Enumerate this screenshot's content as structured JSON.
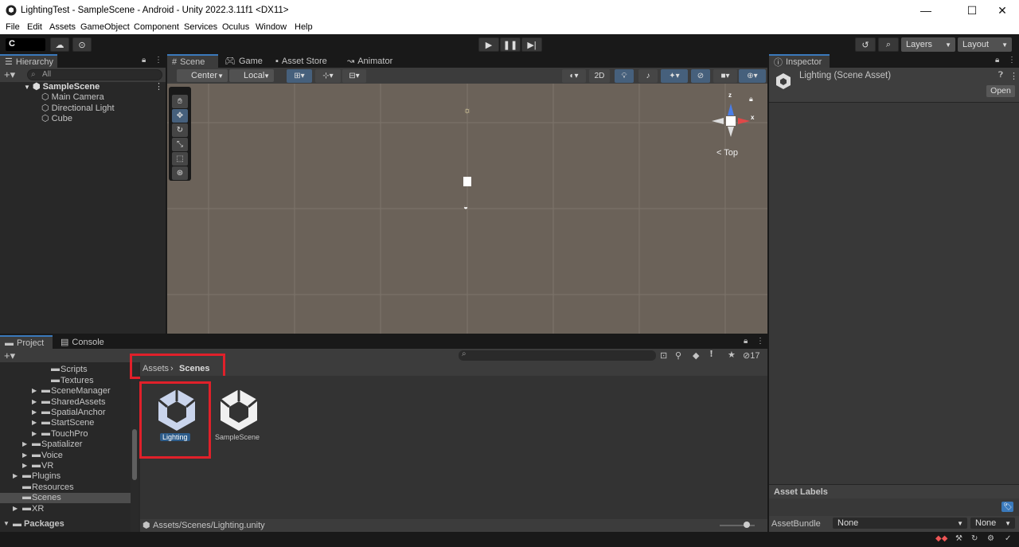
{
  "window": {
    "title": "LightingTest - SampleScene - Android - Unity 2022.3.11f1 <DX11>",
    "minimize": "—",
    "maximize": "☐",
    "close": "✕"
  },
  "menu": [
    "File",
    "Edit",
    "Assets",
    "GameObject",
    "Component",
    "Services",
    "Oculus",
    "Window",
    "Help"
  ],
  "toolbar": {
    "account_label": "C",
    "layers": "Layers",
    "layout": "Layout"
  },
  "hierarchy": {
    "tab": "Hierarchy",
    "search_placeholder": "All",
    "scene": "SampleScene",
    "items": [
      "Main Camera",
      "Directional Light",
      "Cube"
    ]
  },
  "scene_view": {
    "tabs": [
      "Scene",
      "Game",
      "Asset Store",
      "Animator"
    ],
    "pivot": "Center",
    "space": "Local",
    "mode_2d": "2D",
    "gizmo_label": "Top",
    "axis_x": "x",
    "axis_z": "z"
  },
  "inspector": {
    "tab": "Inspector",
    "title": "Lighting (Scene Asset)",
    "open_button": "Open",
    "asset_labels": "Asset Labels",
    "asset_bundle_label": "AssetBundle",
    "asset_bundle_value": "None",
    "asset_bundle_variant": "None"
  },
  "project": {
    "tabs": [
      "Project",
      "Console"
    ],
    "hidden_count": "17",
    "breadcrumb": [
      "Assets",
      "Scenes"
    ],
    "tree": [
      {
        "label": "Scenes",
        "indent": 3,
        "arrow": false
      },
      {
        "label": "Scripts",
        "indent": 3,
        "arrow": false
      },
      {
        "label": "Textures",
        "indent": 3,
        "arrow": false
      },
      {
        "label": "SceneManager",
        "indent": 2,
        "arrow": true
      },
      {
        "label": "SharedAssets",
        "indent": 2,
        "arrow": true
      },
      {
        "label": "SpatialAnchor",
        "indent": 2,
        "arrow": true
      },
      {
        "label": "StartScene",
        "indent": 2,
        "arrow": true
      },
      {
        "label": "TouchPro",
        "indent": 2,
        "arrow": true
      },
      {
        "label": "Spatializer",
        "indent": 1,
        "arrow": true
      },
      {
        "label": "Voice",
        "indent": 1,
        "arrow": true
      },
      {
        "label": "VR",
        "indent": 1,
        "arrow": true
      },
      {
        "label": "Plugins",
        "indent": 0,
        "arrow": true
      },
      {
        "label": "Resources",
        "indent": 0,
        "arrow": false
      },
      {
        "label": "Scenes",
        "indent": 0,
        "arrow": false,
        "selected": true
      },
      {
        "label": "XR",
        "indent": 0,
        "arrow": true
      }
    ],
    "packages": "Packages",
    "assets": [
      {
        "name": "Lighting",
        "selected": true
      },
      {
        "name": "SampleScene",
        "selected": false
      }
    ],
    "status_path": "Assets/Scenes/Lighting.unity"
  },
  "colors": {
    "accent": "#3a79bb",
    "highlight_box": "#e0202a",
    "scene_bg": "#6b6259"
  }
}
